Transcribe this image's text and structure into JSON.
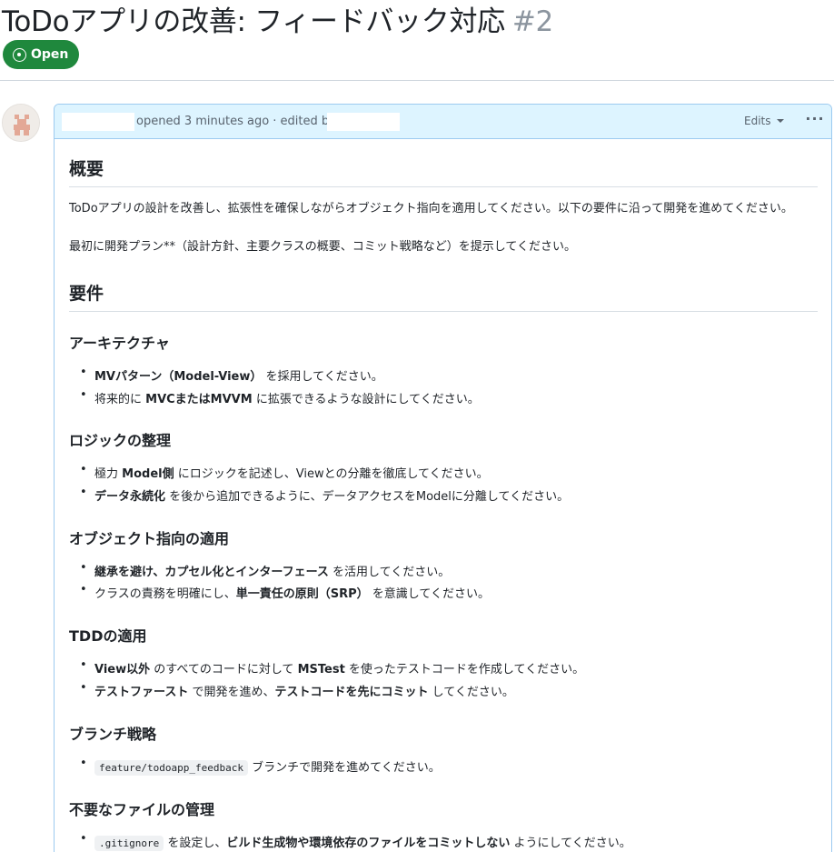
{
  "issue": {
    "title": "ToDoアプリの改善: フィードバック対応",
    "number": "#2",
    "state": "Open"
  },
  "comment": {
    "meta_opened": "opened 3 minutes ago · edited by",
    "edits_label": "Edits",
    "more_label": "···"
  },
  "body": {
    "overview_heading": "概要",
    "overview_p1": "ToDoアプリの設計を改善し、拡張性を確保しながらオブジェクト指向を適用してください。以下の要件に沿って開発を進めてください。",
    "overview_p2": "最初に開発プラン**（設計方針、主要クラスの概要、コミット戦略など）を提示してください。",
    "requirements_heading": "要件",
    "architecture": {
      "heading": "アーキテクチャ",
      "b1_bold": "MVパターン（Model-View）",
      "b1_rest": " を採用してください。",
      "b2_pre": "将来的に ",
      "b2_bold": "MVCまたはMVVM",
      "b2_rest": " に拡張できるような設計にしてください。"
    },
    "logic": {
      "heading": "ロジックの整理",
      "b1_pre": "極力 ",
      "b1_bold": "Model側",
      "b1_rest": " にロジックを記述し、Viewとの分離を徹底してください。",
      "b2_bold": "データ永続化",
      "b2_rest": " を後から追加できるように、データアクセスをModelに分離してください。"
    },
    "oop": {
      "heading": "オブジェクト指向の適用",
      "b1_bold": "継承を避け、カプセル化とインターフェース",
      "b1_rest": " を活用してください。",
      "b2_pre": "クラスの責務を明確にし、",
      "b2_bold": "単一責任の原則（SRP）",
      "b2_rest": " を意識してください。"
    },
    "tdd": {
      "heading": "TDDの適用",
      "b1_bold": "View以外",
      "b1_mid": " のすべてのコードに対して ",
      "b1_bold2": "MSTest",
      "b1_rest": " を使ったテストコードを作成してください。",
      "b2_bold": "テストファースト",
      "b2_mid": " で開発を進め、",
      "b2_bold2": "テストコードを先にコミット",
      "b2_rest": " してください。"
    },
    "branch": {
      "heading": "ブランチ戦略",
      "b1_code": "feature/todoapp_feedback",
      "b1_rest": " ブランチで開発を進めてください。"
    },
    "files": {
      "heading": "不要なファイルの管理",
      "b1_code": ".gitignore",
      "b1_mid": " を設定し、",
      "b1_bold": "ビルド生成物や環境依存のファイルをコミットしない",
      "b1_rest": " ようにしてください。"
    }
  },
  "colors": {
    "open_badge": "#1f883d",
    "comment_header_bg": "#ddf4ff",
    "comment_border": "#9ccaf0"
  }
}
